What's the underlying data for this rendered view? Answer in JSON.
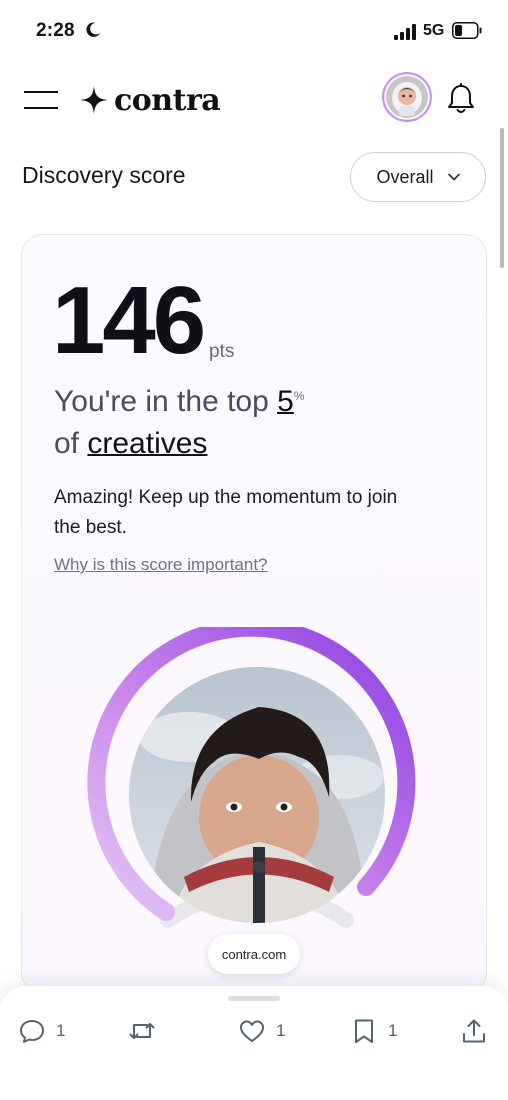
{
  "status_bar": {
    "time": "2:28",
    "network": "5G"
  },
  "nav": {
    "logo_text": "contra"
  },
  "section": {
    "title": "Discovery score",
    "filter_selected": "Overall"
  },
  "score_card": {
    "score": "146",
    "unit": "pts",
    "rank_prefix": "You're in the top",
    "rank_value": "5",
    "rank_percent": "%",
    "rank_of": "of",
    "rank_group": "creatives",
    "message": "Amazing! Keep up the momentum to join the best.",
    "help_link": "Why is this score important?"
  },
  "browser": {
    "domain": "contra.com"
  },
  "tweet_actions": [
    {
      "icon": "reply-icon",
      "count": "1"
    },
    {
      "icon": "retweet-icon",
      "count": ""
    },
    {
      "icon": "like-icon",
      "count": "1"
    },
    {
      "icon": "bookmark-icon",
      "count": "1"
    },
    {
      "icon": "share-icon",
      "count": ""
    }
  ],
  "colors": {
    "ring_start": "#d9b7f1",
    "ring_end": "#8a3ee0",
    "accent": "#b36ae6"
  }
}
